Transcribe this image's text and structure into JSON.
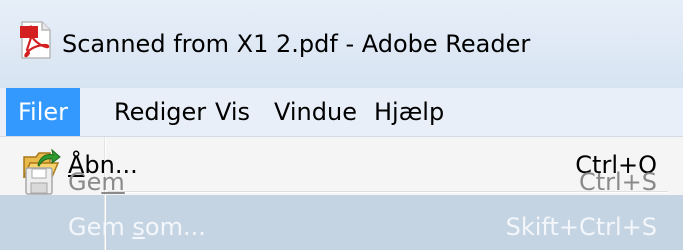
{
  "window": {
    "title": "Scanned from X1 2.pdf - Adobe Reader",
    "icon": "adobe-pdf-icon"
  },
  "menubar": {
    "items": [
      {
        "label": "Filer",
        "active": true
      },
      {
        "label": "Rediger",
        "active": false
      },
      {
        "label": "Vis",
        "active": false
      },
      {
        "label": "Vindue",
        "active": false
      },
      {
        "label": "Hjælp",
        "active": false
      }
    ]
  },
  "file_menu": {
    "items": [
      {
        "icon": "open-folder-icon",
        "label_mnemonic": "Å",
        "label_rest": "bn...",
        "shortcut": "Ctrl+O",
        "enabled": true,
        "highlighted": false
      },
      {
        "icon": "save-disk-icon",
        "label_pre": "Ge",
        "label_mnemonic": "m",
        "label_rest": "",
        "shortcut": "Ctrl+S",
        "enabled": false,
        "highlighted": false
      },
      {
        "label_pre": "Gem ",
        "label_mnemonic": "s",
        "label_rest": "om...",
        "shortcut": "Skift+Ctrl+S",
        "enabled": true,
        "highlighted": true
      }
    ]
  },
  "colors": {
    "menu_active_bg": "#3399ff",
    "row_highlight_bg": "#c5d4e3",
    "disabled_text": "#8a8a8a"
  }
}
